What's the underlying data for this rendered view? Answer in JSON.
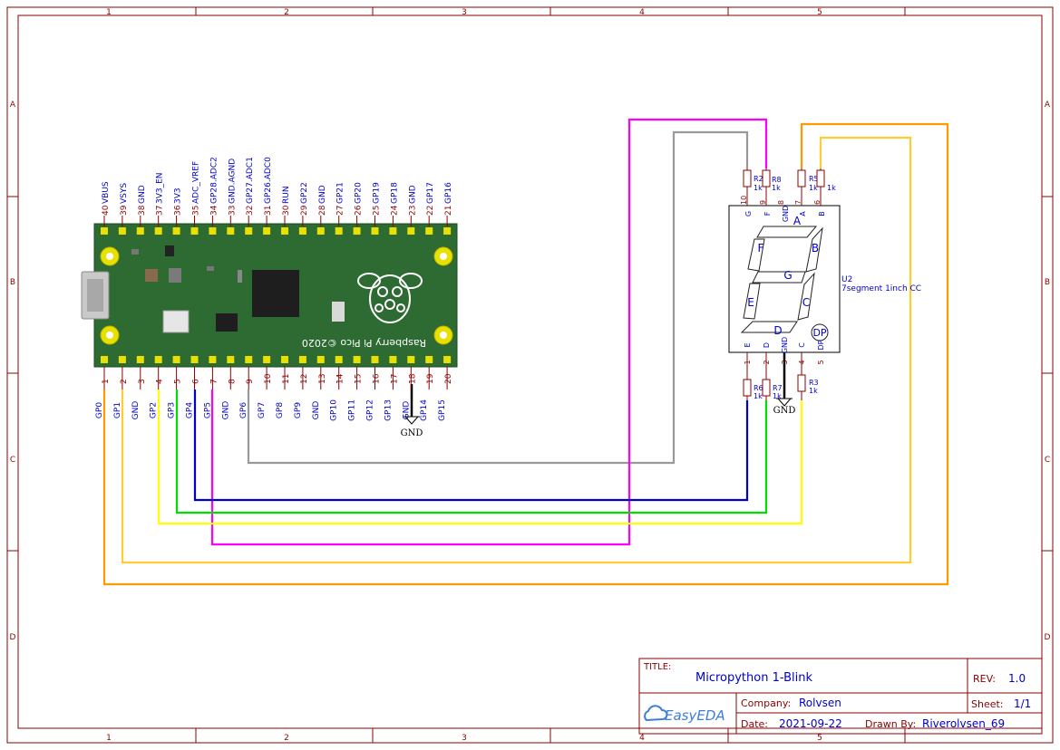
{
  "colors": {
    "frame": "#8b0000",
    "label_blue": "#0000cc",
    "wire_gray": "#999999",
    "wire_magenta": "#ff00ff",
    "wire_orange": "#ff9900",
    "wire_yellow_orange": "#ffcc33",
    "wire_yellow": "#ffff00",
    "wire_green": "#00dd00",
    "wire_blue": "#0000cc",
    "pcb_green": "#2e6b33"
  },
  "frame": {
    "columns": [
      "1",
      "2",
      "3",
      "4",
      "5"
    ],
    "rows": [
      "A",
      "B",
      "C",
      "D"
    ]
  },
  "pico": {
    "top_pins": [
      {
        "num": "40",
        "name": "VBUS"
      },
      {
        "num": "39",
        "name": "VSYS"
      },
      {
        "num": "38",
        "name": "GND"
      },
      {
        "num": "37",
        "name": "3V3_EN"
      },
      {
        "num": "36",
        "name": "3V3"
      },
      {
        "num": "35",
        "name": "ADC_VREF"
      },
      {
        "num": "34",
        "name": "GP28.ADC2"
      },
      {
        "num": "33",
        "name": "GND.AGND"
      },
      {
        "num": "32",
        "name": "GP27.ADC1"
      },
      {
        "num": "31",
        "name": "GP26.ADC0"
      },
      {
        "num": "30",
        "name": "RUN"
      },
      {
        "num": "29",
        "name": "GP22"
      },
      {
        "num": "28",
        "name": "GND"
      },
      {
        "num": "27",
        "name": "GP21"
      },
      {
        "num": "26",
        "name": "GP20"
      },
      {
        "num": "25",
        "name": "GP19"
      },
      {
        "num": "24",
        "name": "GP18"
      },
      {
        "num": "23",
        "name": "GND"
      },
      {
        "num": "22",
        "name": "GP17"
      },
      {
        "num": "21",
        "name": "GP16"
      }
    ],
    "bottom_pins": [
      {
        "num": "1",
        "name": "GP0"
      },
      {
        "num": "2",
        "name": "GP1"
      },
      {
        "num": "3",
        "name": "GND"
      },
      {
        "num": "4",
        "name": "GP2"
      },
      {
        "num": "5",
        "name": "GP3"
      },
      {
        "num": "6",
        "name": "GP4"
      },
      {
        "num": "7",
        "name": "GP5"
      },
      {
        "num": "8",
        "name": "GND"
      },
      {
        "num": "9",
        "name": "GP6"
      },
      {
        "num": "10",
        "name": "GP7"
      },
      {
        "num": "11",
        "name": "GP8"
      },
      {
        "num": "12",
        "name": "GP9"
      },
      {
        "num": "13",
        "name": "GND"
      },
      {
        "num": "14",
        "name": "GP10"
      },
      {
        "num": "15",
        "name": "GP11"
      },
      {
        "num": "16",
        "name": "GP12"
      },
      {
        "num": "17",
        "name": "GP13"
      },
      {
        "num": "18",
        "name": "GND"
      },
      {
        "num": "19",
        "name": "GP14"
      },
      {
        "num": "20",
        "name": "GP15"
      }
    ],
    "board_text": "Raspberry Pi Pico ©2020",
    "gnd_symbol": "GND"
  },
  "display": {
    "designator": "U2",
    "part": "7segment 1inch CC",
    "segments": [
      "A",
      "B",
      "C",
      "D",
      "E",
      "F",
      "G"
    ],
    "dp_label": "DP",
    "top_pins": [
      {
        "num": "10",
        "name": "G"
      },
      {
        "num": "9",
        "name": "F"
      },
      {
        "num": "8",
        "name": "GND"
      },
      {
        "num": "7",
        "name": "A"
      },
      {
        "num": "6",
        "name": "B"
      }
    ],
    "bottom_pins": [
      {
        "num": "1",
        "name": "E"
      },
      {
        "num": "2",
        "name": "D"
      },
      {
        "num": "3",
        "name": "GND"
      },
      {
        "num": "4",
        "name": "C"
      },
      {
        "num": "5",
        "name": "DP"
      }
    ],
    "gnd_symbol": "GND"
  },
  "resistors": {
    "r2": {
      "ref": "R2",
      "val": "1k"
    },
    "r8": {
      "ref": "R8",
      "val": "1k"
    },
    "r5": {
      "ref": "R5",
      "val": "1k"
    },
    "r4": {
      "val": "1k"
    },
    "r6": {
      "ref": "R6",
      "val": "1k"
    },
    "r7": {
      "ref": "R7",
      "val": "1k"
    },
    "r3": {
      "ref": "R3",
      "val": "1k"
    }
  },
  "title_block": {
    "title_label": "TITLE:",
    "title": "Micropython 1-Blink",
    "rev_label": "REV:",
    "rev": "1.0",
    "company_label": "Company:",
    "company": "Rolvsen",
    "sheet_label": "Sheet:",
    "sheet": "1/1",
    "date_label": "Date:",
    "date": "2021-09-22",
    "drawn_label": "Drawn By:",
    "drawn_by": "Riverolvsen_69",
    "logo_text": "EasyEDA"
  }
}
